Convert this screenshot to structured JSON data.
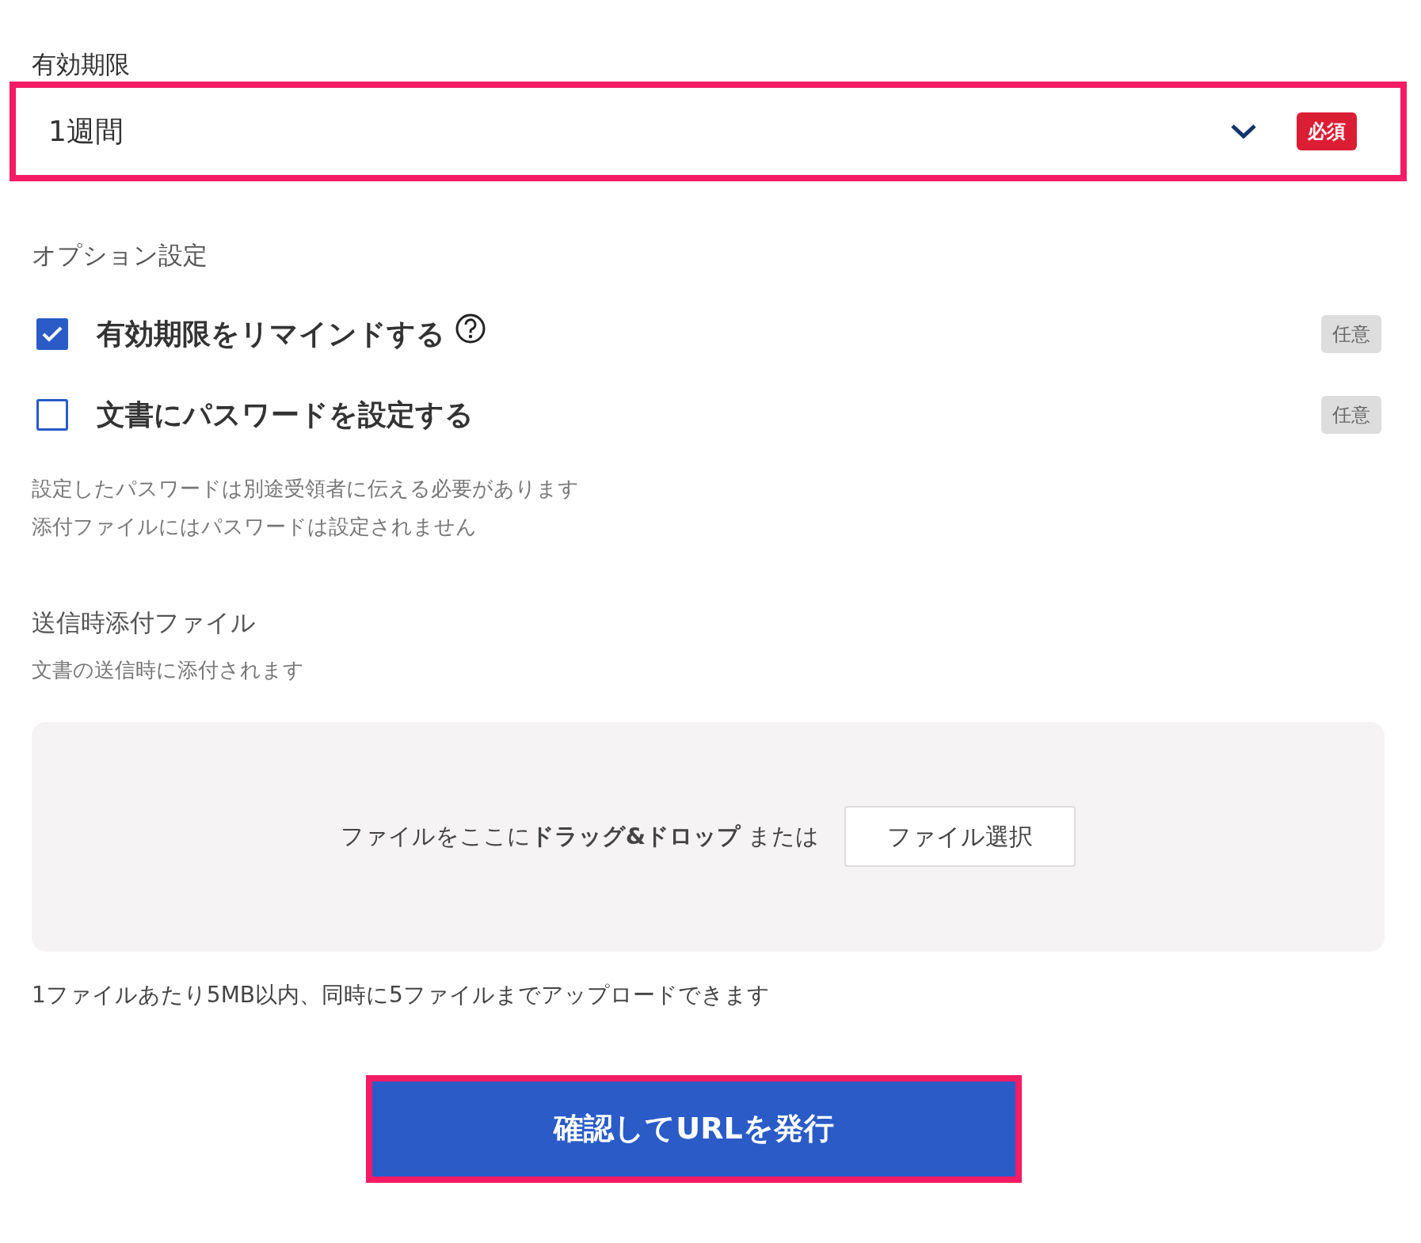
{
  "expiry": {
    "label": "有効期限",
    "value": "1週間",
    "badge": "必須",
    "highlighted": true
  },
  "options": {
    "title": "オプション設定",
    "items": [
      {
        "label": "有効期限をリマインドする",
        "checked": true,
        "help": true,
        "badge": "任意"
      },
      {
        "label": "文書にパスワードを設定する",
        "checked": false,
        "help": false,
        "badge": "任意"
      }
    ],
    "notes": [
      "設定したパスワードは別途受領者に伝える必要があります",
      "添付ファイルにはパスワードは設定されません"
    ]
  },
  "attachments": {
    "title": "送信時添付ファイル",
    "subtitle": "文書の送信時に添付されます",
    "drop_text": "ファイルをここに**ドラッグ&ドロップ** または",
    "select_button": "ファイル選択",
    "limit": "1ファイルあたり5MB以内、同時に5ファイルまでアップロードできます"
  },
  "submit": {
    "label": "確認してURLを発行",
    "highlighted": true
  }
}
